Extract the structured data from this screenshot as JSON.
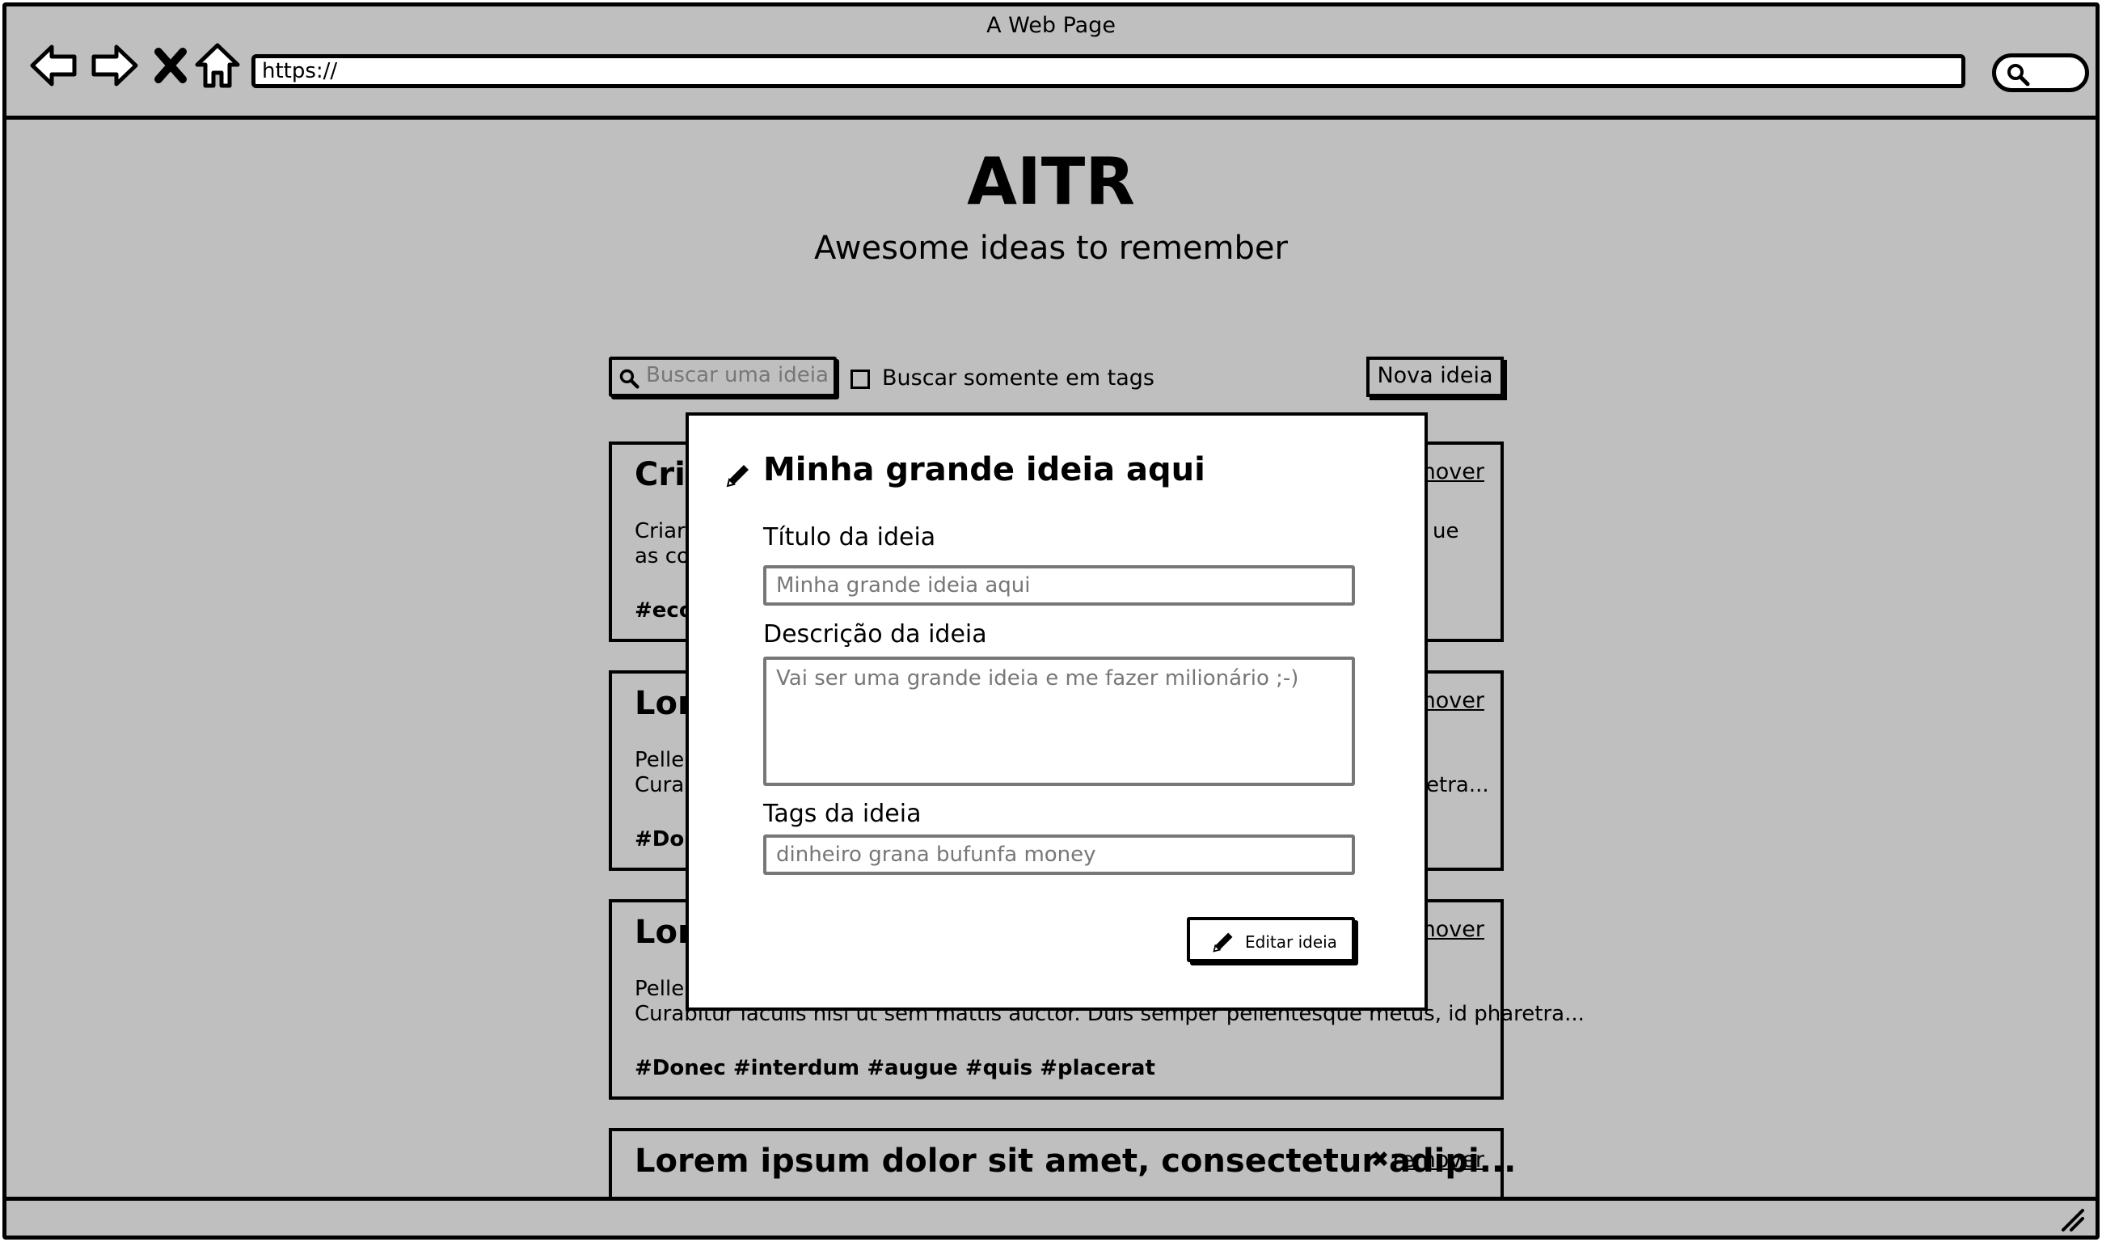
{
  "browser": {
    "window_title": "A Web Page",
    "url": "https://"
  },
  "app": {
    "title": "AITR",
    "subtitle": "Awesome ideas to remember"
  },
  "toolbar": {
    "search_placeholder": "Buscar uma ideia",
    "tags_only_label": "Buscar somente em tags",
    "tags_only_checked": false,
    "new_button": "Nova ideia"
  },
  "cards": [
    {
      "title": "Cri",
      "desc_line1": "Criar",
      "desc_right1": "ue",
      "desc_line2": "as co",
      "desc_right2": "",
      "tags": "#eco",
      "remove": "mover"
    },
    {
      "title": "Lor",
      "desc_line1": "Peller",
      "desc_right1": "",
      "desc_line2": "Cural",
      "desc_right2": "etra...",
      "tags": "#Don",
      "remove": "mover"
    },
    {
      "title": "Lor",
      "desc_line1": "Peller",
      "desc_right1": "",
      "desc_line2": "Curabitur iaculis nisi ut sem mattis auctor. Duis semper pellentesque metus, id pharetra...",
      "desc_right2": "",
      "tags": "#Donec #interdum #augue #quis #placerat",
      "remove": "mover"
    },
    {
      "title": "Lorem ipsum dolor sit amet, consectetur adipi...",
      "remove": "remover"
    }
  ],
  "modal": {
    "title": "Minha grande ideia aqui",
    "title_label": "Título da ideia",
    "title_value": "Minha grande ideia aqui",
    "desc_label": "Descrição da ideia",
    "desc_value": "Vai ser uma grande ideia e me fazer milionário ;-)",
    "tags_label": "Tags da ideia",
    "tags_value": "dinheiro grana bufunfa money",
    "submit_button": "Editar ideia"
  },
  "icons": {
    "back": "arrow-left-icon",
    "forward": "arrow-right-icon",
    "stop": "close-icon",
    "home": "home-icon",
    "search": "search-icon",
    "edit": "pencil-icon",
    "remove": "close-icon"
  }
}
